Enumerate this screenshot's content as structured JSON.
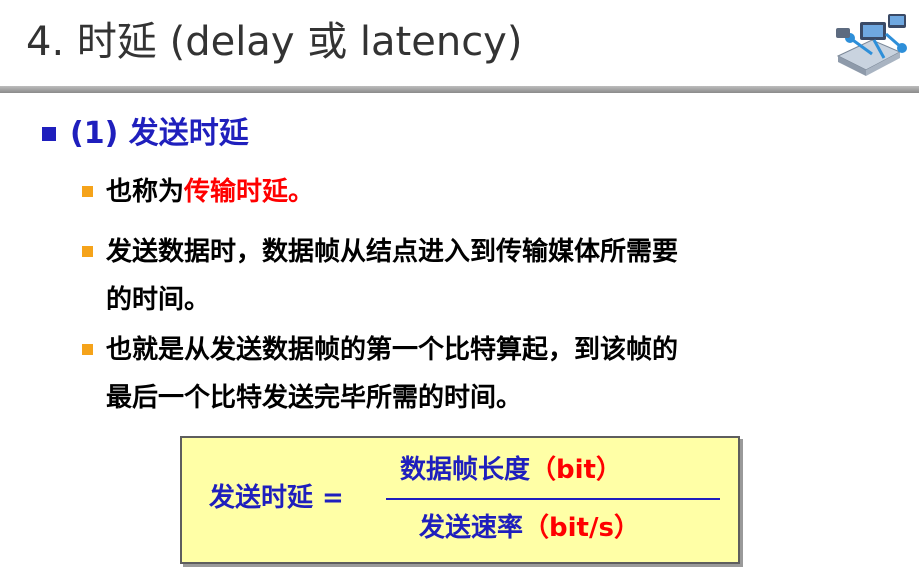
{
  "slide": {
    "title": "4. 时延 (delay 或 latency)"
  },
  "section": {
    "heading": "(1) 发送时延"
  },
  "bullets": {
    "b1_prefix": "也称为",
    "b1_highlight": "传输时延",
    "b1_suffix": "。",
    "b2_line1": "发送数据时，数据帧从结点进入到传输媒体所需要",
    "b2_line2": "的时间。",
    "b3_line1": "也就是从发送数据帧的第一个比特算起，到该帧的",
    "b3_line2": "最后一个比特发送完毕所需的时间。"
  },
  "formula": {
    "lhs": "发送时延 =",
    "numerator": "数据帧长度",
    "numerator_unit": "（bit）",
    "denominator": "发送速率",
    "denominator_unit": "（bit/s）"
  },
  "colors": {
    "title": "#333333",
    "accent_blue": "#1f1fbd",
    "highlight_red": "#ff0000",
    "bullet_orange": "#f5a31a",
    "formula_bg": "#ffffa6"
  },
  "icons": {
    "logo": "network-devices-icon"
  }
}
